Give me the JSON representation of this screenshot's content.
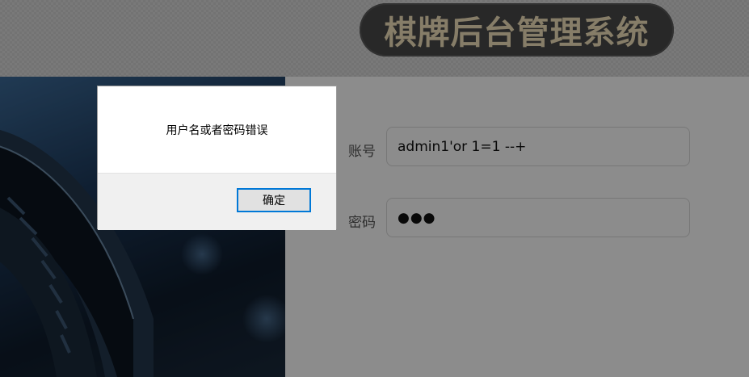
{
  "header": {
    "title": "棋牌后台管理系统"
  },
  "login_form": {
    "account_label": "账号",
    "account_value": "admin1'or 1=1 --+",
    "password_label": "密码",
    "password_value": "●●●"
  },
  "dialog": {
    "message": "用户名或者密码错误",
    "ok_label": "确定"
  },
  "colors": {
    "title_pill": "#4a4a4a",
    "title_text": "#f5e3bd",
    "focus_border": "#0078d7"
  }
}
